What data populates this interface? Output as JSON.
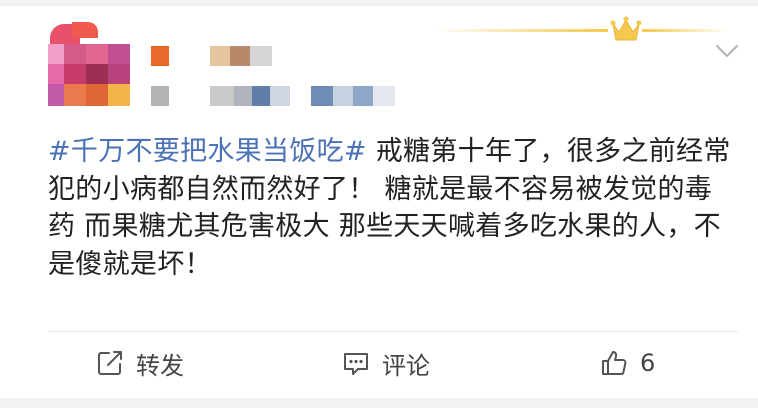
{
  "post": {
    "hashtag": "#千万不要把水果当饭吃#",
    "body": " 戒糖第十年了，很多之前经常犯的小病都自然而然好了！ 糖就是最不容易被发觉的毒药 而果糖尤其危害极大 那些天天喊着多吃水果的人，不是傻就是坏！"
  },
  "actions": {
    "repost_label": "转发",
    "comment_label": "评论",
    "like_count": "6"
  },
  "icons": {
    "repost": "repost-icon",
    "comment": "comment-icon",
    "like": "thumbs-up-icon",
    "crown": "crown-icon",
    "more": "chevron-down-icon"
  },
  "colors": {
    "hashtag": "#4b71b7",
    "text": "#222222",
    "crown": "#f6c84e"
  }
}
